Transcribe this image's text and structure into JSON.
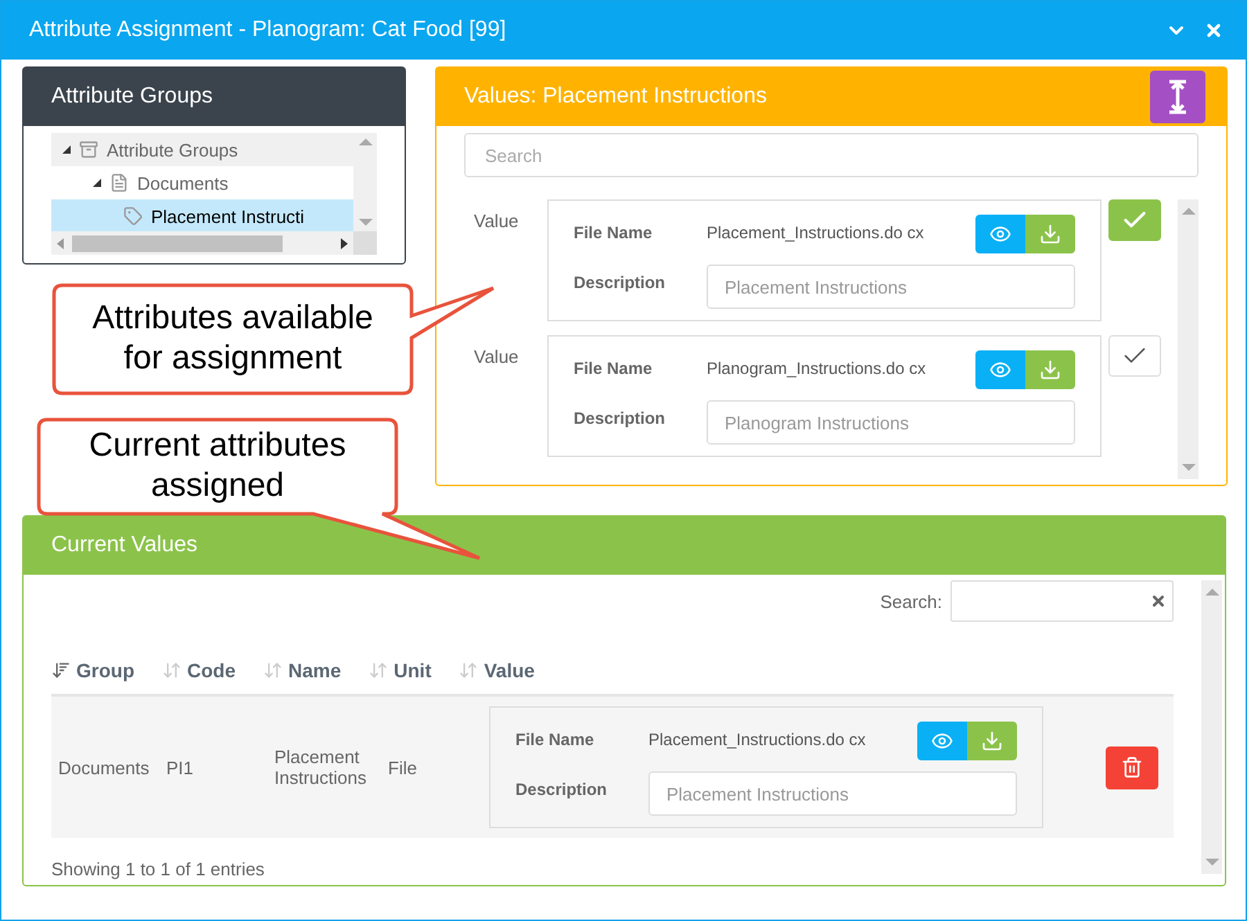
{
  "window": {
    "title": "Attribute Assignment - Planogram: Cat Food [99]"
  },
  "groups_panel": {
    "title": "Attribute Groups",
    "tree": [
      {
        "label": "Attribute Groups",
        "expanded": true,
        "selected": false,
        "children": [
          {
            "label": "Documents",
            "expanded": true,
            "selected": false,
            "children": [
              {
                "label": "Placement Instructi",
                "selected": true
              }
            ]
          }
        ]
      }
    ]
  },
  "values_panel": {
    "title": "Values: Placement Instructions",
    "search": {
      "placeholder": "Search"
    },
    "values": [
      {
        "label": "Value",
        "file_name_label": "File Name",
        "file_name": "Placement_Instructions.do cx",
        "description_label": "Description",
        "description": "Placement Instructions",
        "selected": true
      },
      {
        "label": "Value",
        "file_name_label": "File Name",
        "file_name": "Planogram_Instructions.do cx",
        "description_label": "Description",
        "description": "Planogram Instructions",
        "selected": false
      }
    ]
  },
  "callouts": [
    {
      "text": "Attributes available for assignment"
    },
    {
      "text": "Current attributes assigned"
    }
  ],
  "current_panel": {
    "title": "Current Values",
    "search_label": "Search:",
    "columns": [
      {
        "label": "Group",
        "sorted": true
      },
      {
        "label": "Code",
        "sorted": false
      },
      {
        "label": "Name",
        "sorted": false
      },
      {
        "label": "Unit",
        "sorted": false
      },
      {
        "label": "Value",
        "sorted": false
      }
    ],
    "rows": [
      {
        "group": "Documents",
        "code": "PI1",
        "name": "Placement Instructions",
        "unit": "File",
        "file_name_label": "File Name",
        "file_name": "Placement_Instructions.do cx",
        "description_label": "Description",
        "description": "Placement Instructions"
      }
    ],
    "footer": "Showing 1 to 1 of 1 entries"
  }
}
